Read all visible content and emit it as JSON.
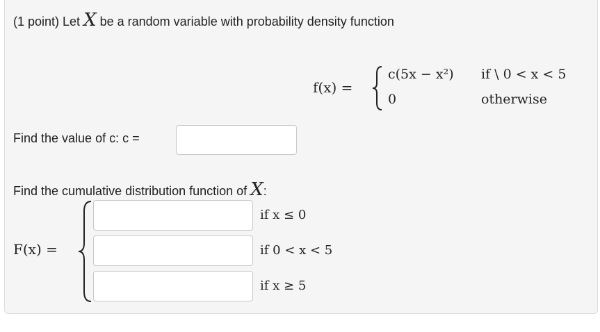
{
  "problem": {
    "prefix": "(1 point) Let",
    "var_X": "X",
    "suffix": "be a random variable with probability density function"
  },
  "pdf": {
    "lhs": "f(x) =",
    "case1_expr": "c(5x − x²)",
    "case1_cond": "if \\ 0 < x < 5",
    "case2_expr": "0",
    "case2_cond": "otherwise"
  },
  "find_c": {
    "label": "Find the value of c: c =",
    "value": ""
  },
  "find_cdf": {
    "label_prefix": "Find the cumulative distribution function of",
    "var_X": "X",
    "colon": ":",
    "lhs": "F(x) =",
    "rows": [
      {
        "value": "",
        "cond": "if x ≤ 0"
      },
      {
        "value": "",
        "cond": "if 0 < x < 5"
      },
      {
        "value": "",
        "cond": "if x ≥ 5"
      }
    ]
  }
}
